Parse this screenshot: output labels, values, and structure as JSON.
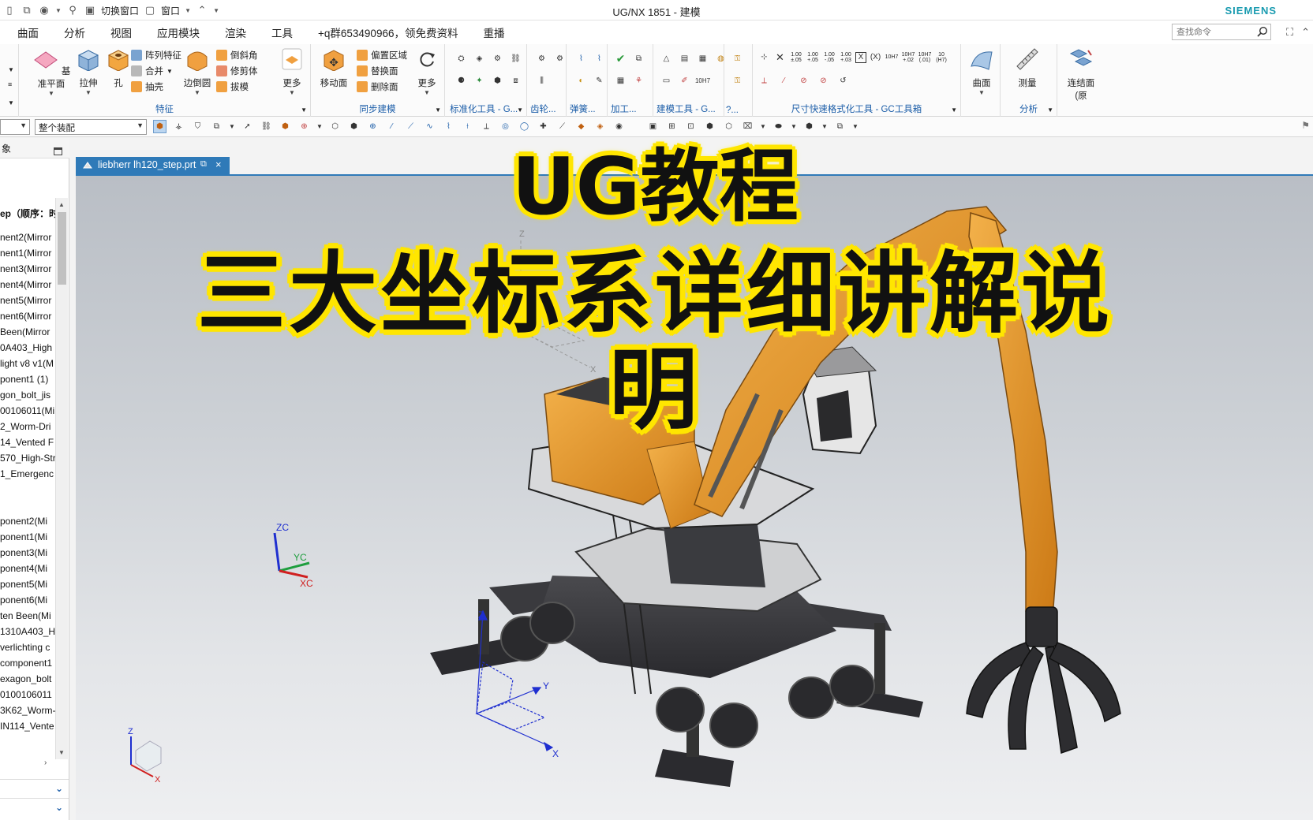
{
  "titlebar": {
    "switch_window": "切换窗口",
    "window": "窗口",
    "title": "UG/NX 1851 - 建模",
    "brand": "SIEMENS"
  },
  "menu": [
    "曲面",
    "分析",
    "视图",
    "应用模块",
    "渲染",
    "工具",
    "+q群653490966，领免费资料",
    "重播"
  ],
  "search": {
    "placeholder": "查找命令"
  },
  "ribbon": {
    "feature": {
      "label": "特征",
      "datum_plane": "基准平面",
      "extrude": "拉伸",
      "hole": "孔",
      "pattern_feature": "阵列特征",
      "unite": "合并",
      "shell": "抽壳",
      "edge_blend": "边倒圆",
      "chamfer": "倒斜角",
      "trim_body": "修剪体",
      "draft": "拔模",
      "more": "更多"
    },
    "sync": {
      "label": "同步建模",
      "move_face": "移动面",
      "offset_region": "偏置区域",
      "replace_face": "替换面",
      "delete_face": "删除面",
      "more": "更多"
    },
    "std_tools": {
      "label": "标准化工具 - G..."
    },
    "gear": {
      "label": "齿轮..."
    },
    "spring": {
      "label": "弹簧..."
    },
    "machining": {
      "label": "加工..."
    },
    "model_tools": {
      "label": "建模工具 - G..."
    },
    "more_group": {
      "label": "?..."
    },
    "dim_tools": {
      "label": "尺寸快速格式化工具 - GC工具箱"
    },
    "surface": {
      "label": "曲面"
    },
    "analysis": {
      "label": "分析",
      "measure": "测量"
    },
    "connect": {
      "label1": "连结面",
      "label2": "(原"
    }
  },
  "selection": {
    "filter_value": "",
    "scope_value": "整个装配"
  },
  "navigator": {
    "title": "象",
    "header": "ep（顺序：时",
    "items": [
      "nent2(Mirror",
      "nent1(Mirror",
      "nent3(Mirror",
      "nent4(Mirror",
      "nent5(Mirror",
      "nent6(Mirror",
      "Been(Mirror",
      "0A403_High",
      "light v8 v1(M",
      "ponent1 (1)",
      "gon_bolt_jis",
      "00106011(Mi",
      "2_Worm-Dri",
      "14_Vented F",
      "570_High-Str",
      "1_Emergenc"
    ],
    "items2": [
      "ponent2(Mi",
      "ponent1(Mi",
      "ponent3(Mi",
      "ponent4(Mi",
      "ponent5(Mi",
      "ponent6(Mi",
      "ten Been(Mi",
      "1310A403_H",
      "verlichting c",
      "component1",
      "exagon_bolt",
      "0100106011",
      "3K62_Worm-",
      "IN114_Vente"
    ]
  },
  "graphics": {
    "tab_label": "liebherr lh120_step.prt",
    "wcs": {
      "z": "Z",
      "x": "X",
      "y": "Y"
    },
    "csys": {
      "zc": "ZC",
      "yc": "YC",
      "xc": "XC"
    },
    "triad": {
      "z": "Z",
      "x": "X"
    }
  },
  "caption": {
    "line1": "UG教程",
    "line2": "三大坐标系详细讲解说明"
  },
  "colors": {
    "accent": "#2f7ab8",
    "machine_orange": "#e89a2a",
    "caption_outline": "#ffe600",
    "brand": "#1a9bb0"
  }
}
